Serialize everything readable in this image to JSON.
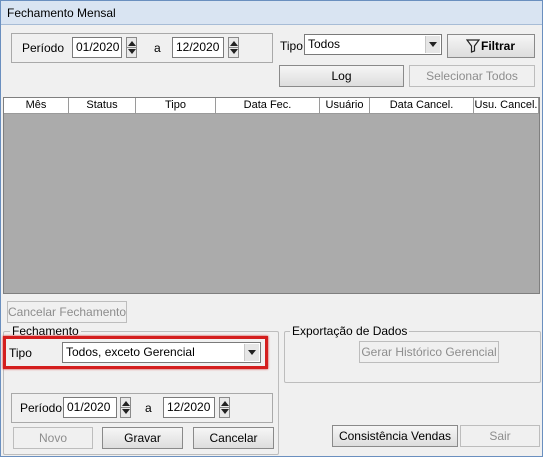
{
  "window": {
    "title": "Fechamento Mensal"
  },
  "filters": {
    "periodo_label": "Período",
    "from": "01/2020",
    "to_label": "a",
    "to": "12/2020",
    "tipo_label": "Tipo",
    "tipo_value": "Todos",
    "filtrar_label": "Filtrar",
    "log_label": "Log",
    "selecionar_todos_label": "Selecionar Todos"
  },
  "table": {
    "columns": [
      "Mês",
      "Status",
      "Tipo",
      "Data Fec.",
      "Usuário",
      "Data Cancel.",
      "Usu. Cancel."
    ]
  },
  "actions": {
    "cancelar_fechamento_label": "Cancelar Fechamento"
  },
  "fechamento": {
    "title": "Fechamento",
    "tipo_label": "Tipo",
    "tipo_value": "Todos, exceto Gerencial",
    "periodo_label": "Período",
    "from": "01/2020",
    "to_label": "a",
    "to": "12/2020",
    "novo_label": "Novo",
    "gravar_label": "Gravar",
    "cancelar_label": "Cancelar"
  },
  "exportacao": {
    "title": "Exportação de Dados",
    "gerar_label": "Gerar Histórico Gerencial"
  },
  "footer": {
    "consistencia_label": "Consistência Vendas",
    "sair_label": "Sair"
  },
  "colors": {
    "highlight": "#d41e1e",
    "grid_bg": "#ababab"
  }
}
